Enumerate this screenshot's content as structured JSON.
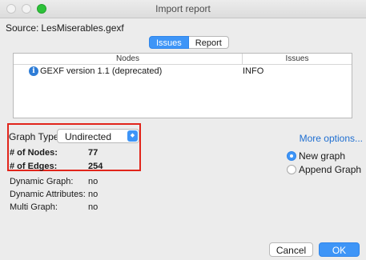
{
  "window": {
    "title": "Import report"
  },
  "source": {
    "label": "Source:",
    "value": "LesMiserables.gexf"
  },
  "tabs": [
    {
      "label": "Issues",
      "active": true
    },
    {
      "label": "Report",
      "active": false
    }
  ],
  "issues_table": {
    "columns": [
      "Nodes",
      "Issues"
    ],
    "rows": [
      {
        "icon": "info-icon",
        "message": "GEXF version 1.1 (deprecated)",
        "level": "INFO"
      }
    ]
  },
  "graph_type": {
    "label": "Graph Type:",
    "value": "Undirected"
  },
  "stats": {
    "nodes_label": "# of Nodes:",
    "nodes_value": "77",
    "edges_label": "# of Edges:",
    "edges_value": "254",
    "dynamic_graph_label": "Dynamic Graph:",
    "dynamic_graph_value": "no",
    "dynamic_attributes_label": "Dynamic Attributes:",
    "dynamic_attributes_value": "no",
    "multi_graph_label": "Multi Graph:",
    "multi_graph_value": "no"
  },
  "more_options": "More options...",
  "options": [
    {
      "label": "New graph",
      "selected": true
    },
    {
      "label": "Append Graph",
      "selected": false
    }
  ],
  "buttons": {
    "cancel": "Cancel",
    "ok": "OK"
  },
  "colors": {
    "accent": "#3e95f7",
    "highlight": "#e1251b",
    "link": "#1f6fd1"
  }
}
